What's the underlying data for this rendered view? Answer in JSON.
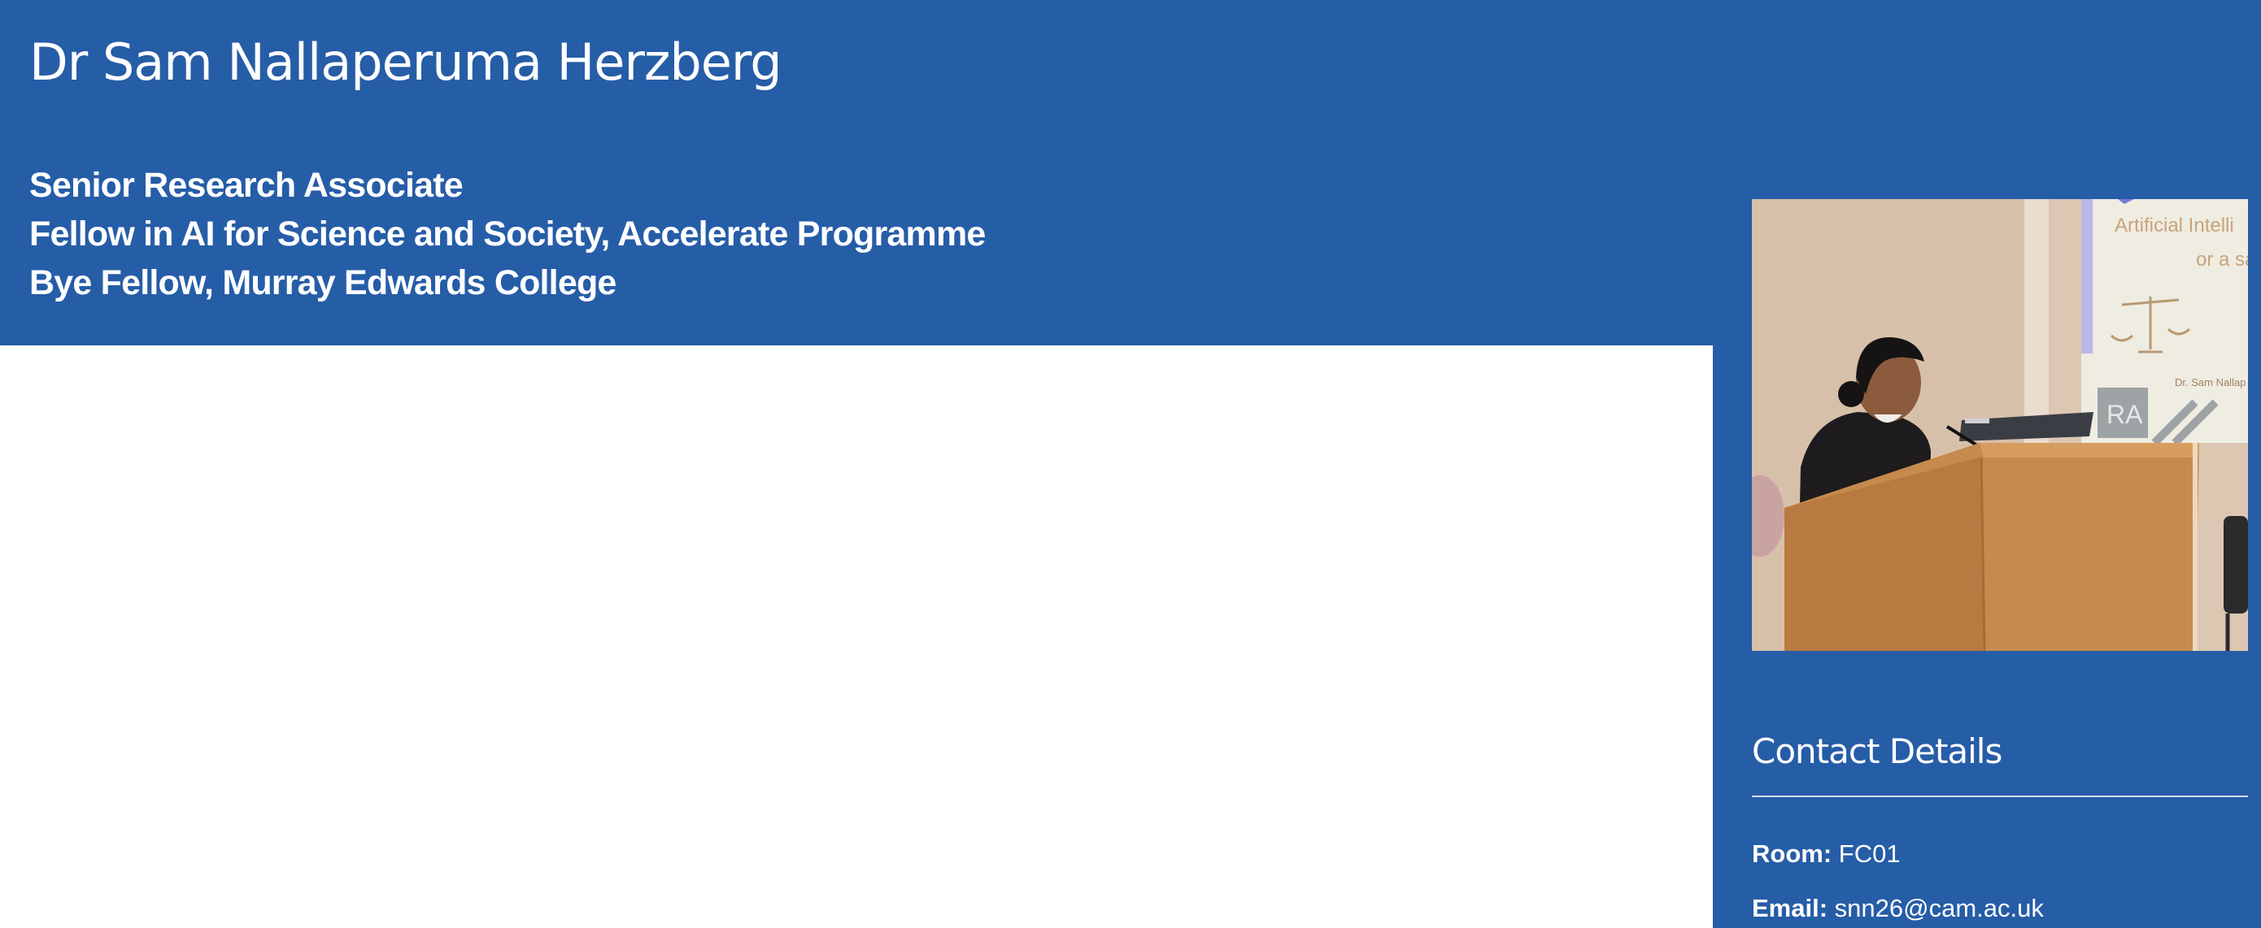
{
  "profile": {
    "name": "Dr Sam Nallaperuma Herzberg",
    "roles": [
      "Senior Research Associate",
      "Fellow in AI for Science and Society, Accelerate Programme",
      "Bye Fellow, Murray Edwards College"
    ]
  },
  "photo": {
    "slide_text_line1": "Artificial Intelli",
    "slide_text_line2": "or a sa",
    "slide_presenter": "Dr. Sam Nallap",
    "slide_logo": "RA"
  },
  "contact": {
    "title": "Contact Details",
    "room_label": "Room:",
    "room_value": "FC01",
    "email_label": "Email:",
    "email_value": "snn26@cam.ac.uk"
  },
  "colors": {
    "brand_blue": "#265da7",
    "text_on_brand": "#ffffff"
  }
}
